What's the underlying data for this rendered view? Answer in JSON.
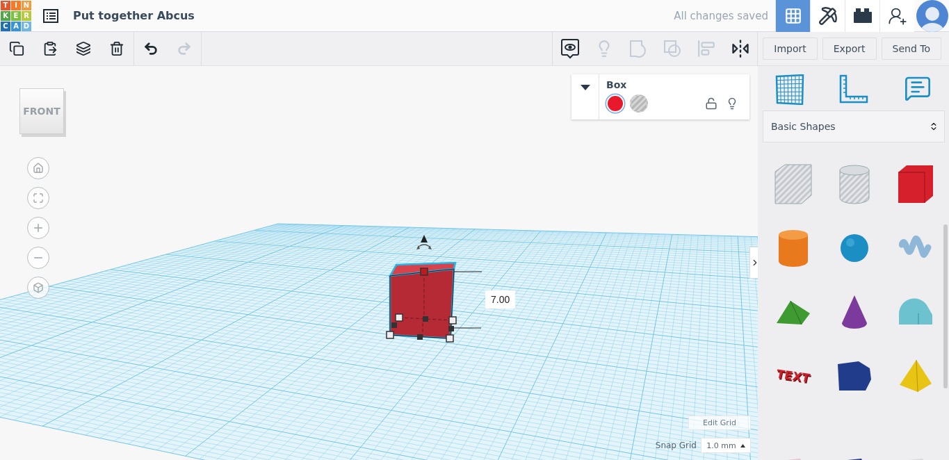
{
  "header": {
    "logo": [
      {
        "letter": "T",
        "color": "#e9552b"
      },
      {
        "letter": "I",
        "color": "#f47b2a"
      },
      {
        "letter": "N",
        "color": "#f49a3a"
      },
      {
        "letter": "K",
        "color": "#4fa845"
      },
      {
        "letter": "E",
        "color": "#7fbf3f"
      },
      {
        "letter": "R",
        "color": "#b5cb3c"
      },
      {
        "letter": "C",
        "color": "#1e6fb5"
      },
      {
        "letter": "A",
        "color": "#3794d4"
      },
      {
        "letter": "D",
        "color": "#6db8e4"
      }
    ],
    "title": "Put together Abcus",
    "save_status": "All changes saved",
    "nav": [
      {
        "kind": "grid",
        "selected": true
      },
      {
        "kind": "pickaxe",
        "selected": false
      },
      {
        "kind": "brick",
        "selected": false
      }
    ]
  },
  "toolbar": {
    "edit_tools": [
      {
        "kind": "copy",
        "disabled": false
      },
      {
        "kind": "paste",
        "disabled": false
      },
      {
        "kind": "duplicate",
        "disabled": false
      },
      {
        "kind": "delete",
        "disabled": false
      },
      {
        "kind": "undo",
        "disabled": false
      },
      {
        "kind": "redo",
        "disabled": true
      }
    ],
    "shape_tools": [
      {
        "kind": "notes",
        "disabled": false
      },
      {
        "kind": "light",
        "disabled": true
      },
      {
        "kind": "group",
        "disabled": true
      },
      {
        "kind": "ungroup",
        "disabled": true
      },
      {
        "kind": "align",
        "disabled": true
      },
      {
        "kind": "mirror",
        "disabled": false
      }
    ],
    "actions": [
      "Import",
      "Export",
      "Send To"
    ]
  },
  "view_cube": {
    "face": "FRONT"
  },
  "inspector": {
    "title": "Box",
    "swatches": [
      {
        "kind": "solid",
        "color": "#e8192c",
        "selected": true
      },
      {
        "kind": "hole",
        "selected": false
      }
    ],
    "locked": false
  },
  "workplane": {
    "dimension": "7.00",
    "edit_grid": "Edit Grid",
    "snap_label": "Snap Grid",
    "snap_value": "1.0 mm"
  },
  "library": {
    "tabs": [
      {
        "kind": "grid"
      },
      {
        "kind": "ruler"
      },
      {
        "kind": "notes"
      }
    ],
    "category": "Basic Shapes",
    "shapes": [
      {
        "kind": "hole-box",
        "color": "#c4c7cc"
      },
      {
        "kind": "hole-cylinder",
        "color": "#c4c7cc"
      },
      {
        "kind": "box",
        "color": "#d6202c"
      },
      {
        "kind": "cylinder",
        "color": "#e8791c"
      },
      {
        "kind": "sphere",
        "color": "#1b8fc4"
      },
      {
        "kind": "scribble",
        "color": "#8fb8d8"
      },
      {
        "kind": "roof",
        "color": "#3f9a32"
      },
      {
        "kind": "cone",
        "color": "#7b3a9c"
      },
      {
        "kind": "round-roof",
        "color": "#6cc3cf"
      },
      {
        "kind": "text",
        "color": "#c9202a",
        "label": "TEXT"
      },
      {
        "kind": "prism",
        "color": "#223c8c"
      },
      {
        "kind": "pyramid",
        "color": "#e8c415"
      },
      {
        "kind": "cut-off",
        "color": "#e8c3cf"
      },
      {
        "kind": "cut-off",
        "color": "#223c8c"
      },
      {
        "kind": "cut-off",
        "color": "#d8d8dc"
      }
    ]
  }
}
